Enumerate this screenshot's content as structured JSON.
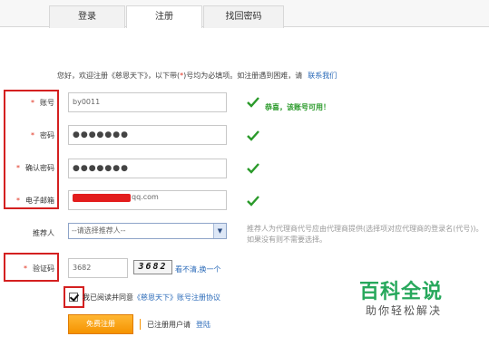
{
  "tabs": [
    {
      "label": "登录",
      "active": false
    },
    {
      "label": "注册",
      "active": true
    },
    {
      "label": "找回密码",
      "active": false
    }
  ],
  "intro": {
    "prefix": "您好，欢迎注册《慈恩天下》，以下带(",
    "star": "*",
    "suffix": ")号均为必填项。如注册遇到困难，请",
    "contact": "联系我们"
  },
  "form": {
    "required_mark": "*",
    "account": {
      "label": "账号",
      "value": "by0011",
      "status": "恭喜，该账号可用！"
    },
    "password": {
      "label": "密码",
      "value": "●●●●●●●"
    },
    "confirm": {
      "label": "确认密码",
      "value": "●●●●●●●"
    },
    "email": {
      "label": "电子邮箱",
      "visible_suffix": "qq.com"
    },
    "referrer": {
      "label": "推荐人",
      "selected": "--请选择推荐人--",
      "hint": "推荐人为代理商代号应由代理商提供(选择项对应代理商的登录名(代号))。如果没有则不需要选择。"
    },
    "captcha": {
      "label": "验证码",
      "value": "3682",
      "image_text": "3682",
      "refresh": "看不清,换一个"
    },
    "agree": {
      "text": "我已阅读并同意",
      "link": "《慈恩天下》账号注册协议"
    },
    "submit": "免费注册",
    "registered": "已注册用户请",
    "login": "登陆"
  },
  "colors": {
    "accent": "#f59300",
    "link": "#2a6ab8",
    "ok": "#2a9a2a",
    "required": "#e0301e",
    "annotation": "#d42020"
  },
  "watermark": {
    "title": "百科全说",
    "subtitle": "助你轻松解决"
  }
}
